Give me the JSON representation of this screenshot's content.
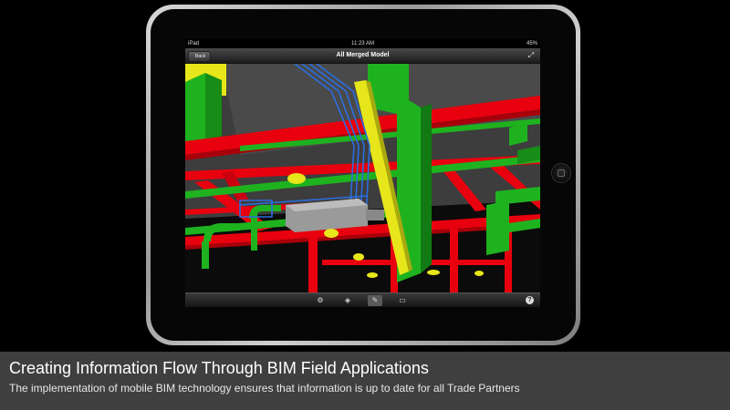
{
  "status_bar": {
    "carrier": "iPad",
    "time": "11:23 AM",
    "battery": "45%"
  },
  "nav_bar": {
    "back_label": "Back",
    "title": "All Merged Model",
    "expand_icon": "expand-icon"
  },
  "toolbar": {
    "tools": [
      {
        "name": "orbit-tool-icon",
        "glyph": "⚙"
      },
      {
        "name": "view-tool-icon",
        "glyph": "◈"
      },
      {
        "name": "markup-tool-icon",
        "glyph": "✎",
        "active": true
      },
      {
        "name": "measure-tool-icon",
        "glyph": "▭"
      }
    ],
    "help_label": "?"
  },
  "caption": {
    "title": "Creating Information Flow Through BIM Field Applications",
    "subtitle": "The implementation of mobile BIM technology ensures that information is up to date for all Trade Partners"
  },
  "colors": {
    "pipe_red": "#e8000e",
    "pipe_green": "#1fb21f",
    "pipe_yellow": "#e6e61a",
    "pipe_blue": "#2a6fe0",
    "model_background": "#3d3d3d",
    "caption_band": "#3f3f3f"
  }
}
